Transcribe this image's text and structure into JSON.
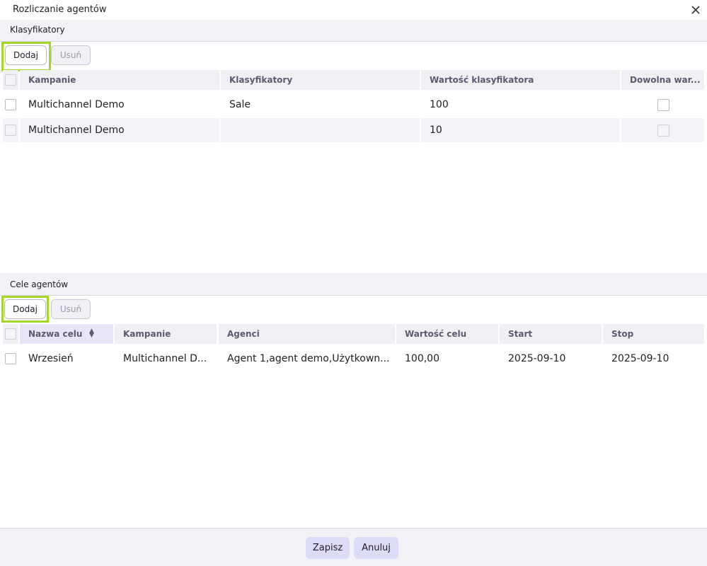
{
  "dialog": {
    "title": "Rozliczanie agentów"
  },
  "classifiers": {
    "section_title": "Klasyfikatory",
    "add_label": "Dodaj",
    "delete_label": "Usuń",
    "columns": [
      "Kampanie",
      "Klasyfikatory",
      "Wartość klasyfikatora",
      "Dowolna war..."
    ],
    "rows": [
      {
        "campaign": "Multichannel Demo",
        "classifier": "Sale",
        "value": "100",
        "any_value": false
      },
      {
        "campaign": "Multichannel Demo",
        "classifier": "",
        "value": "10",
        "any_value": false
      }
    ]
  },
  "agent_goals": {
    "section_title": "Cele agentów",
    "add_label": "Dodaj",
    "delete_label": "Usuń",
    "columns": [
      "Nazwa celu",
      "Kampanie",
      "Agenci",
      "Wartość celu",
      "Start",
      "Stop"
    ],
    "rows": [
      {
        "name": "Wrzesień",
        "campaign": "Multichannel D...",
        "agents": "Agent 1,agent demo,Użytkown...",
        "goal_value": "100,00",
        "start": "2025-09-10",
        "stop": "2025-09-10"
      }
    ]
  },
  "footer": {
    "save_label": "Zapisz",
    "cancel_label": "Anuluj"
  },
  "colors": {
    "highlight": "#a3d82a",
    "footer_button": "#dcdcf6",
    "header_bg": "#efeff4"
  },
  "icons": {
    "close": "close-icon",
    "sort": "sort-icon"
  }
}
